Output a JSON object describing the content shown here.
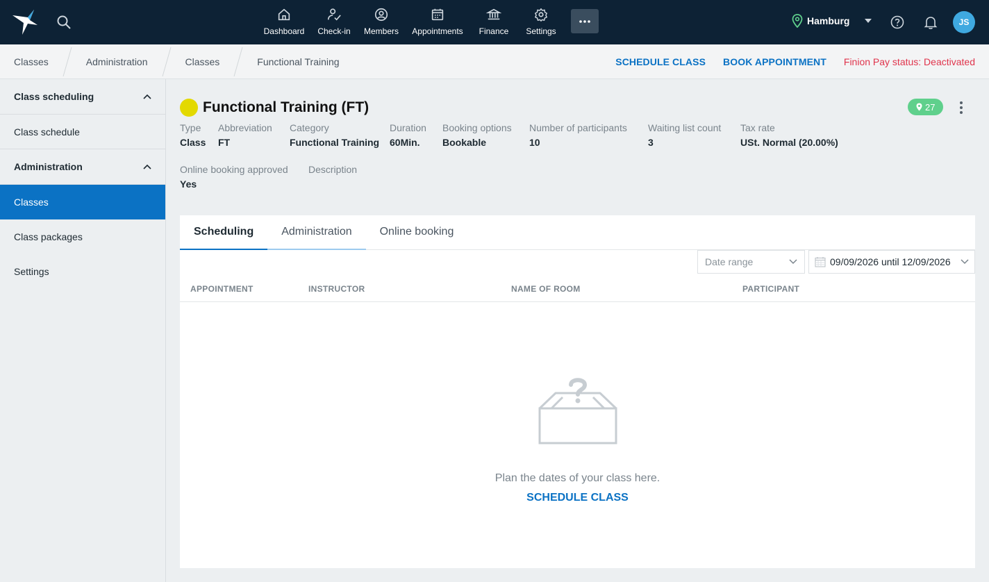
{
  "topbar": {
    "nav": [
      {
        "label": "Dashboard",
        "icon": "home-icon"
      },
      {
        "label": "Check-in",
        "icon": "check-in-icon"
      },
      {
        "label": "Members",
        "icon": "members-icon"
      },
      {
        "label": "Appointments",
        "icon": "calendar-icon"
      },
      {
        "label": "Finance",
        "icon": "bank-icon"
      },
      {
        "label": "Settings",
        "icon": "gear-icon"
      }
    ],
    "more_label": "···",
    "location": "Hamburg",
    "avatar_initials": "JS"
  },
  "breadcrumb": [
    "Classes",
    "Administration",
    "Classes",
    "Functional Training"
  ],
  "actions": {
    "schedule_class": "SCHEDULE CLASS",
    "book_appointment": "BOOK APPOINTMENT",
    "pay_status": "Finion Pay status: Deactivated"
  },
  "sidebar": {
    "sections": [
      {
        "label": "Class scheduling",
        "items": [
          "Class schedule"
        ]
      },
      {
        "label": "Administration",
        "items": [
          "Classes",
          "Class packages",
          "Settings"
        ]
      }
    ],
    "active_item": "Classes"
  },
  "class": {
    "title": "Functional Training (FT)",
    "color": "#e3d900",
    "badge_count": "27",
    "meta_row1": [
      {
        "label": "Type",
        "value": "Class"
      },
      {
        "label": "Abbreviation",
        "value": "FT"
      },
      {
        "label": "Category",
        "value": "Functional Training"
      },
      {
        "label": "Duration",
        "value": "60Min."
      },
      {
        "label": "Booking options",
        "value": "Bookable"
      },
      {
        "label": "Number of participants",
        "value": "10"
      },
      {
        "label": "Waiting list count",
        "value": "3"
      },
      {
        "label": "Tax rate",
        "value": "USt. Normal (20.00%)"
      }
    ],
    "meta_row2": [
      {
        "label": "Online booking approved",
        "value": "Yes"
      },
      {
        "label": "Description",
        "value": ""
      }
    ]
  },
  "tabs": [
    "Scheduling",
    "Administration",
    "Online booking"
  ],
  "active_tab": "Scheduling",
  "filters": {
    "date_range_placeholder": "Date range",
    "date_value": "09/09/2026 until 12/09/2026"
  },
  "table": {
    "columns": [
      "APPOINTMENT",
      "INSTRUCTOR",
      "NAME OF ROOM",
      "PARTICIPANT"
    ]
  },
  "empty_state": {
    "text": "Plan the dates of your class here.",
    "link": "SCHEDULE CLASS"
  },
  "colors": {
    "accent": "#0b72c4",
    "topbar": "#0d2235",
    "badge": "#5fd08c",
    "alert": "#e0344c"
  }
}
